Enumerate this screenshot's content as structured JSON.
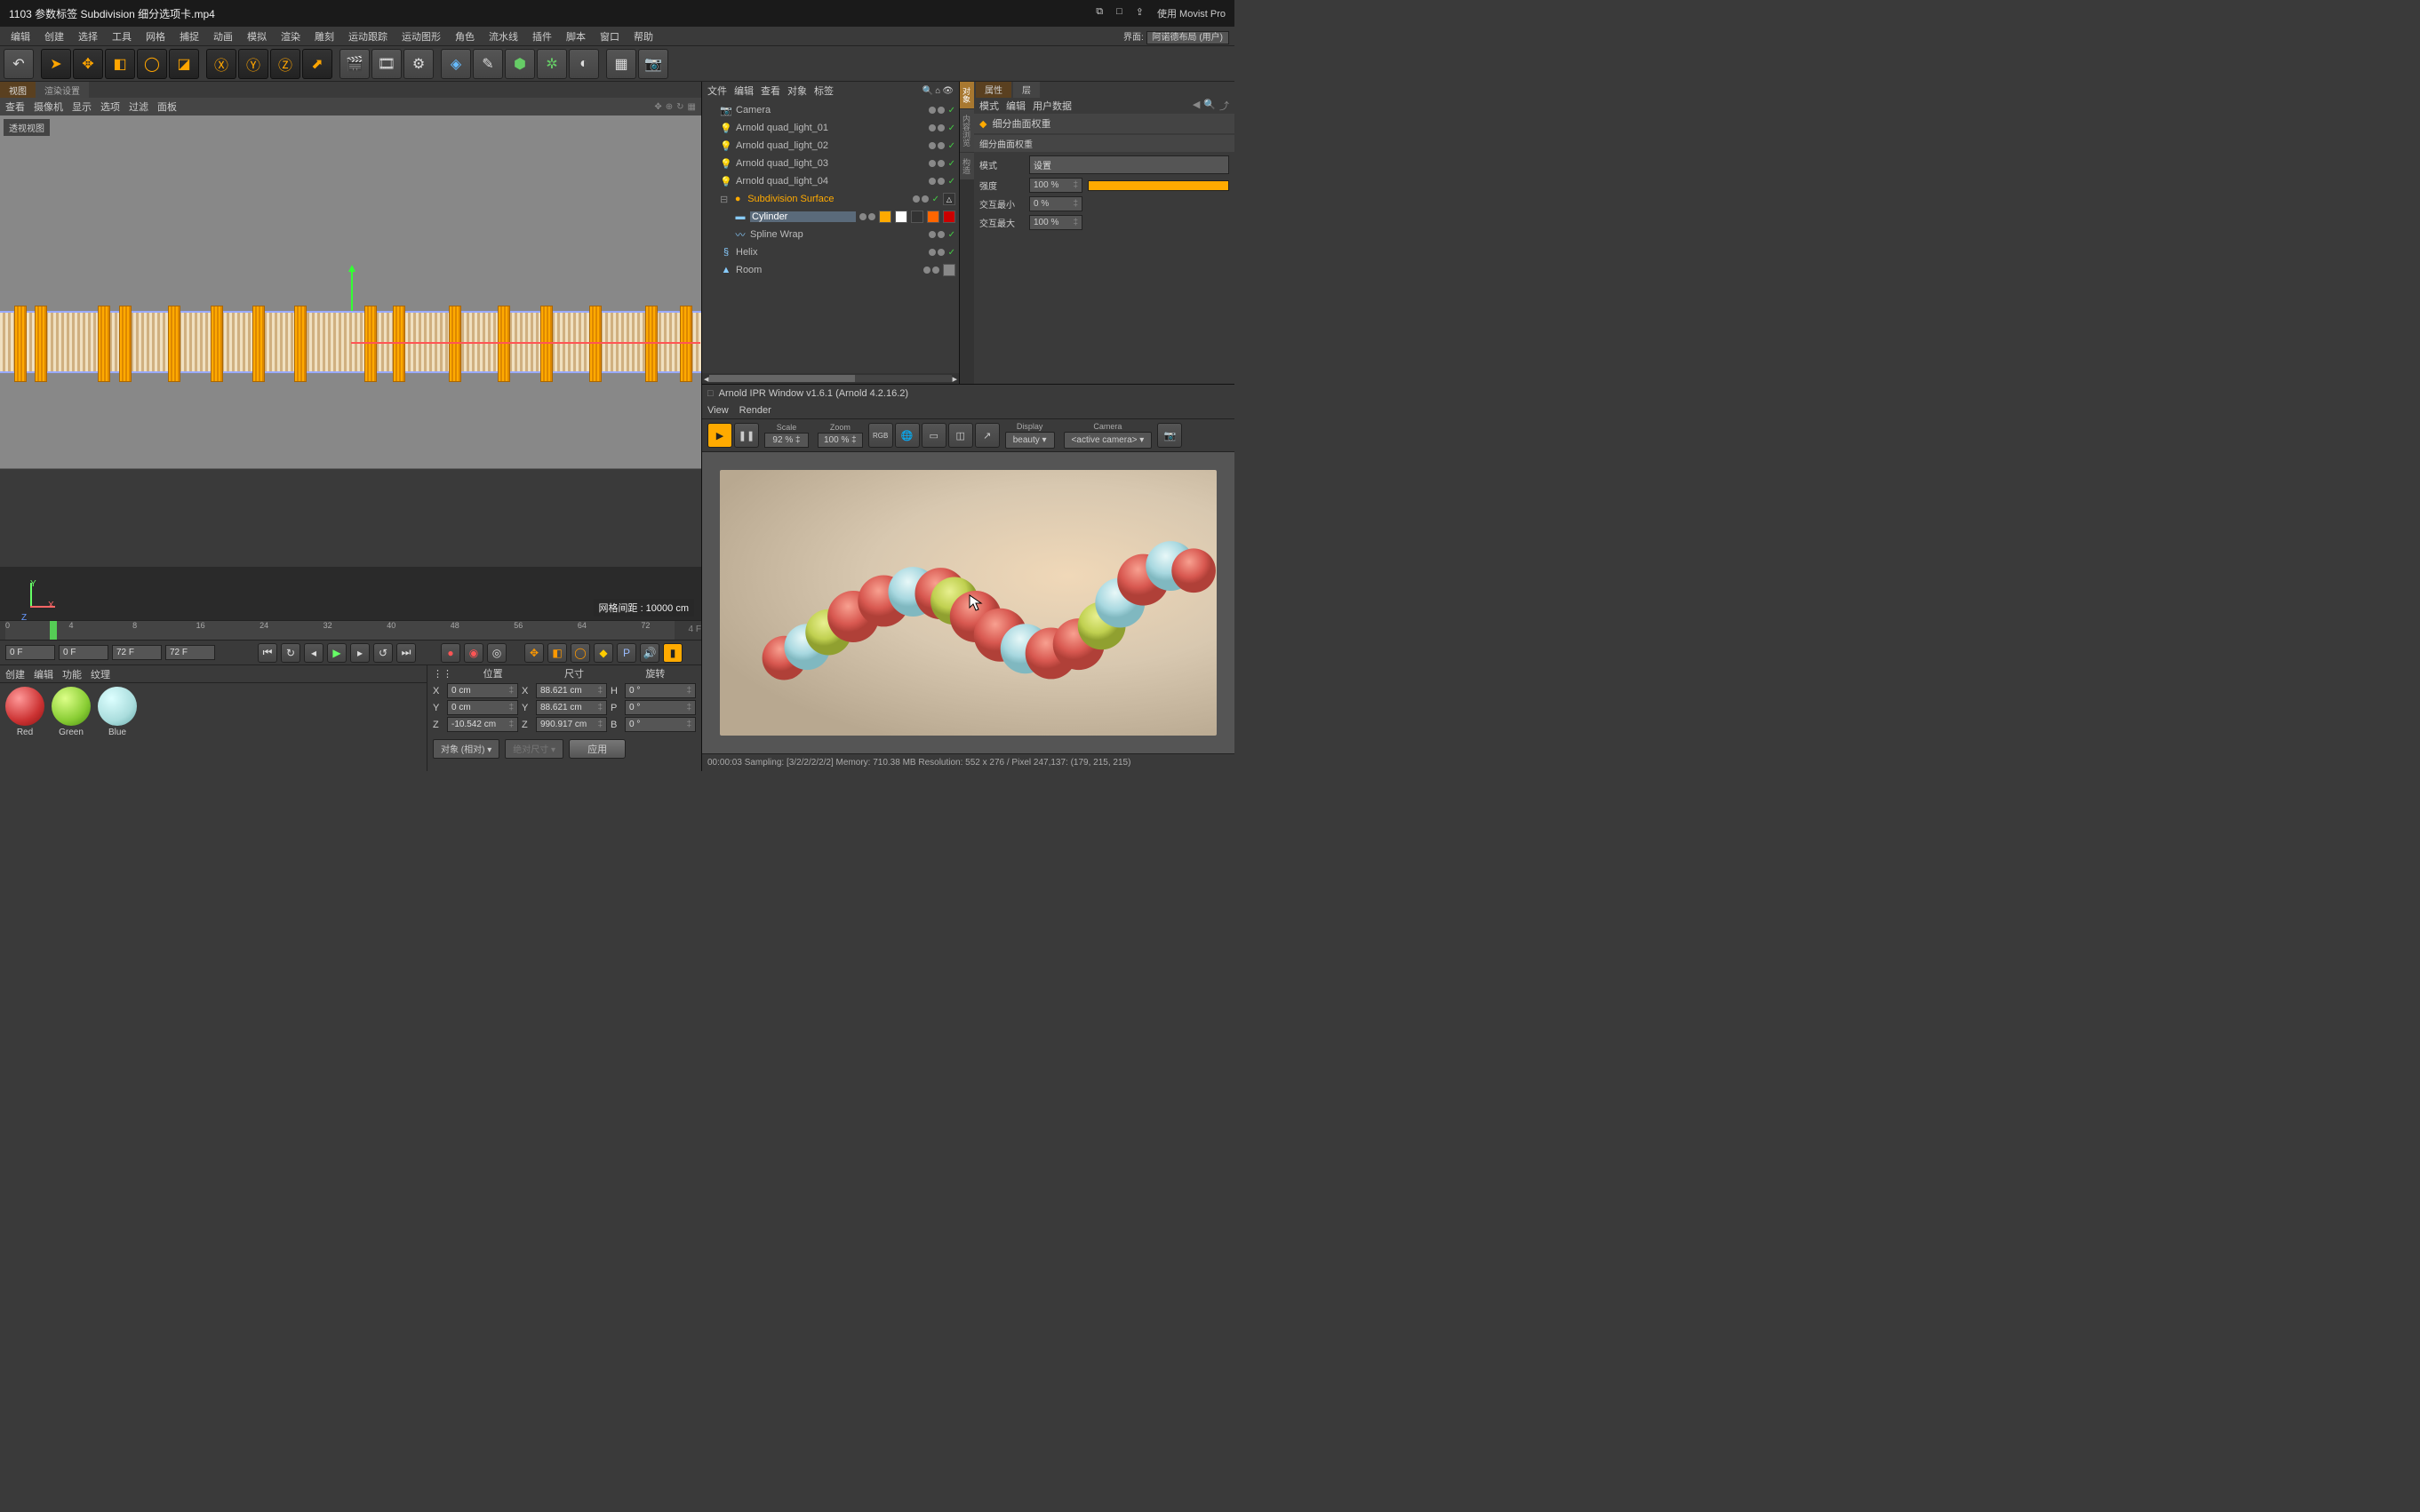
{
  "titlebar": {
    "title": "1103 参数标签 Subdivision 细分选项卡.mp4",
    "use_app": "使用 Movist Pro"
  },
  "menubar": {
    "items": [
      "编辑",
      "创建",
      "选择",
      "工具",
      "网格",
      "捕捉",
      "动画",
      "模拟",
      "渲染",
      "雕刻",
      "运动跟踪",
      "运动图形",
      "角色",
      "流水线",
      "插件",
      "脚本",
      "窗口",
      "帮助"
    ],
    "layout_label": "界面:",
    "layout_value": "阿诺德布局 (用户)"
  },
  "viewport": {
    "tabs": [
      "视图",
      "渲染设置"
    ],
    "menu": [
      "查看",
      "摄像机",
      "显示",
      "选项",
      "过滤",
      "面板"
    ],
    "label": "透视视图",
    "grid_info": "网格间距 : 10000 cm"
  },
  "timeline": {
    "start": "0 F",
    "loop_start": "0 F",
    "loop_end": "72 F",
    "current": "72 F",
    "display_end": "4 F",
    "ticks": [
      "0",
      "4",
      "8",
      "16",
      "24",
      "32",
      "40",
      "48",
      "56",
      "64",
      "72"
    ]
  },
  "materials": {
    "menu": [
      "创建",
      "编辑",
      "功能",
      "纹理"
    ],
    "items": [
      {
        "name": "Red",
        "color": "red"
      },
      {
        "name": "Green",
        "color": "green"
      },
      {
        "name": "Blue",
        "color": "blue"
      }
    ]
  },
  "coords": {
    "headers": [
      "位置",
      "尺寸",
      "旋转"
    ],
    "rows": [
      {
        "axis": "X",
        "pos": "0 cm",
        "size_axis": "X",
        "size": "88.621 cm",
        "rot_axis": "H",
        "rot": "0 °"
      },
      {
        "axis": "Y",
        "pos": "0 cm",
        "size_axis": "Y",
        "size": "88.621 cm",
        "rot_axis": "P",
        "rot": "0 °"
      },
      {
        "axis": "Z",
        "pos": "-10.542 cm",
        "size_axis": "Z",
        "size": "990.917 cm",
        "rot_axis": "B",
        "rot": "0 °"
      }
    ],
    "mode": "对象 (相对)",
    "size_mode": "绝对尺寸",
    "apply": "应用"
  },
  "object_mgr": {
    "menu": [
      "文件",
      "编辑",
      "查看",
      "对象",
      "标签"
    ],
    "items": [
      {
        "indent": 0,
        "icon": "cam",
        "name": "Camera",
        "sel": false,
        "tags": [
          "check"
        ]
      },
      {
        "indent": 0,
        "icon": "light",
        "name": "Arnold quad_light_01",
        "sel": false,
        "tags": [
          "check"
        ]
      },
      {
        "indent": 0,
        "icon": "light",
        "name": "Arnold quad_light_02",
        "sel": false,
        "tags": [
          "check"
        ]
      },
      {
        "indent": 0,
        "icon": "light",
        "name": "Arnold quad_light_03",
        "sel": false,
        "tags": [
          "check"
        ]
      },
      {
        "indent": 0,
        "icon": "light",
        "name": "Arnold quad_light_04",
        "sel": false,
        "tags": [
          "check"
        ]
      },
      {
        "indent": 0,
        "icon": "sds",
        "name": "Subdivision Surface",
        "sel": false,
        "color": "#fa0",
        "tags": [
          "check",
          "warn"
        ]
      },
      {
        "indent": 1,
        "icon": "cyl",
        "name": "Cylinder",
        "sel": true,
        "tags": [
          "tag1",
          "tag2",
          "tag3",
          "tag4",
          "tag5"
        ]
      },
      {
        "indent": 1,
        "icon": "wrap",
        "name": "Spline Wrap",
        "sel": false,
        "tags": [
          "check"
        ]
      },
      {
        "indent": 0,
        "icon": "helix",
        "name": "Helix",
        "sel": false,
        "tags": [
          "check"
        ]
      },
      {
        "indent": 0,
        "icon": "room",
        "name": "Room",
        "sel": false,
        "tags": [
          "tex"
        ]
      }
    ]
  },
  "side_tabs": [
    "对象",
    "内容浏览",
    "构造"
  ],
  "attributes": {
    "tabs": [
      "属性",
      "层"
    ],
    "menu": [
      "模式",
      "编辑",
      "用户数据"
    ],
    "title": "细分曲面权重",
    "section": "细分曲面权重",
    "mode_label": "模式",
    "mode_value": "设置",
    "strength_label": "强度",
    "strength_value": "100 %",
    "inter_min_label": "交互最小",
    "inter_min_value": "0 %",
    "inter_max_label": "交互最大",
    "inter_max_value": "100 %"
  },
  "ipr": {
    "title": "Arnold IPR Window v1.6.1 (Arnold 4.2.16.2)",
    "menu": [
      "View",
      "Render"
    ],
    "scale_label": "Scale",
    "scale_value": "92 %",
    "zoom_label": "Zoom",
    "zoom_value": "100 %",
    "display_label": "Display",
    "display_value": "beauty",
    "camera_label": "Camera",
    "camera_value": "<active camera>",
    "rgb": "RGB",
    "status": "00:00:03  Sampling: [3/2/2/2/2/2]    Memory: 710.38 MB    Resolution: 552 x 276 / Pixel 247,137: (179, 215, 215)"
  }
}
